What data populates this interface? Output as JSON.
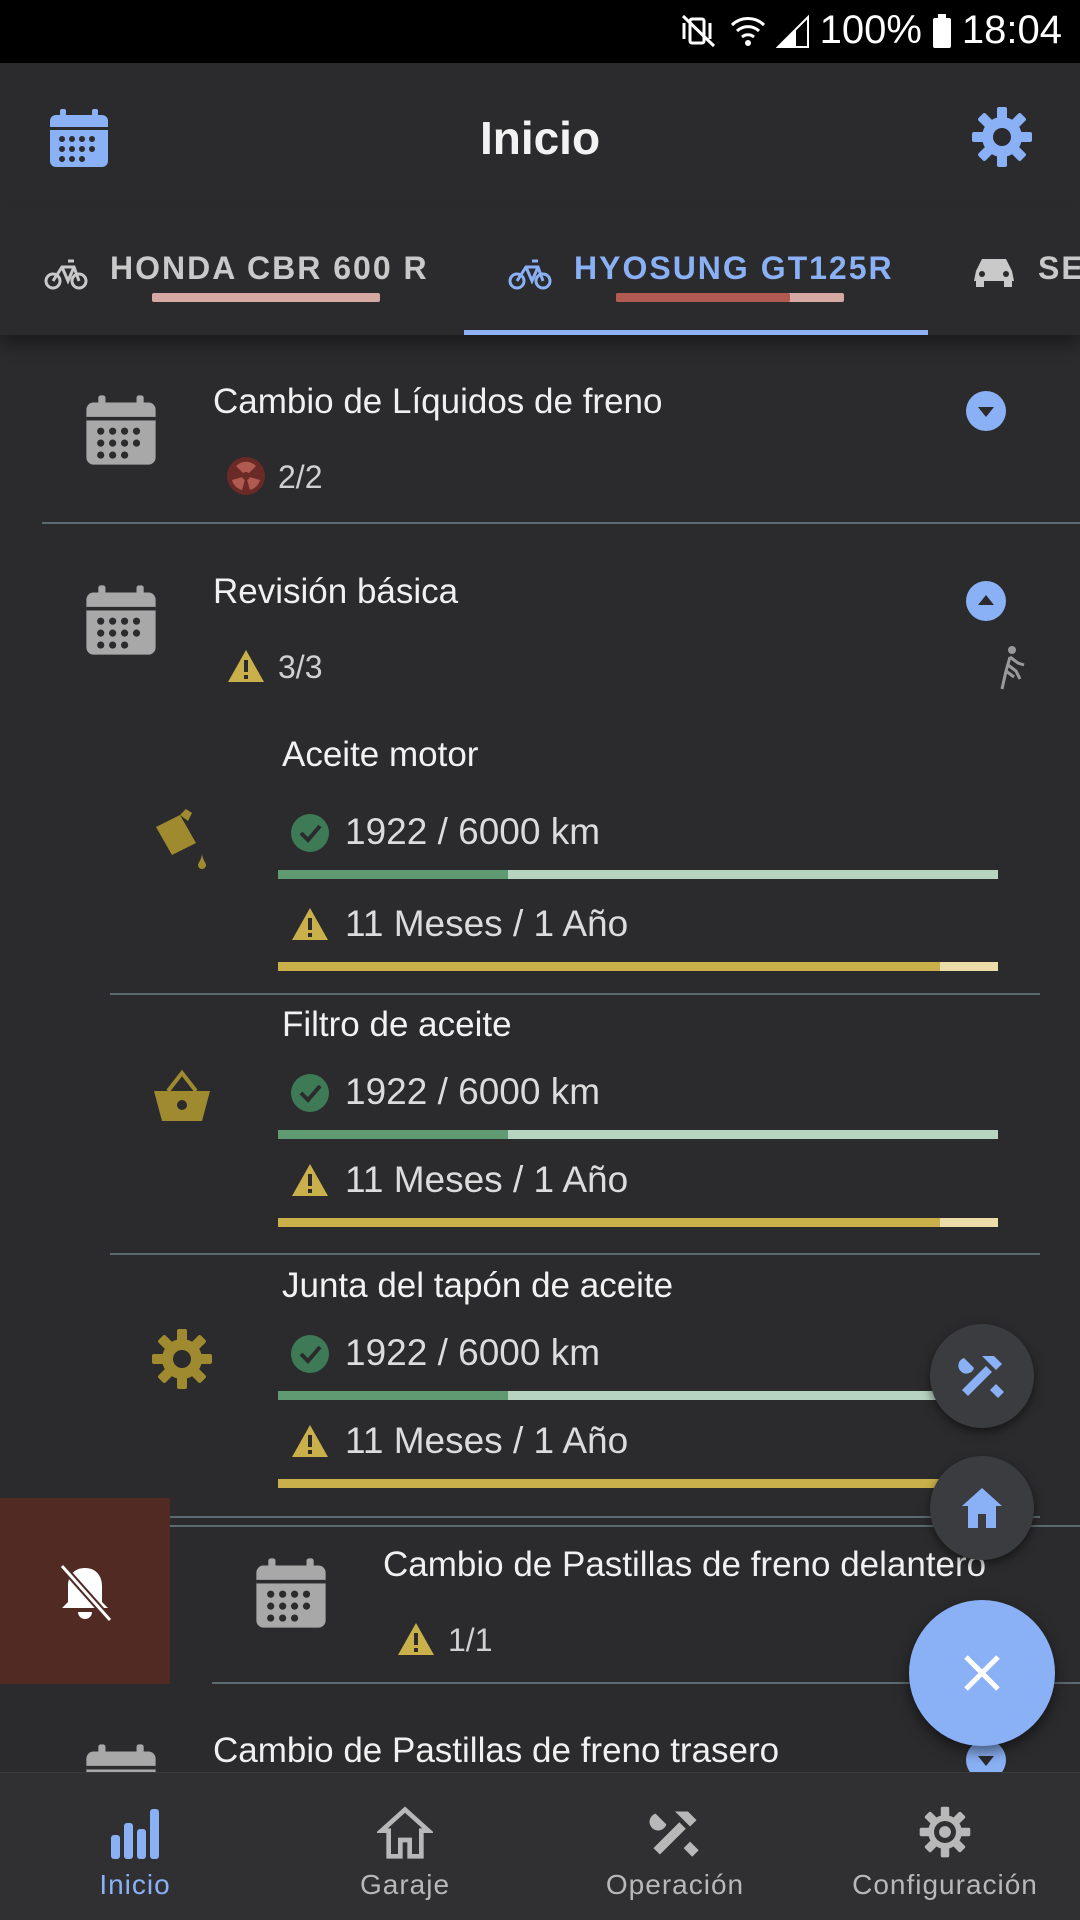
{
  "status_bar": {
    "battery": "100%",
    "time": "18:04"
  },
  "app_bar": {
    "title": "Inicio"
  },
  "tabs": [
    {
      "label": "HONDA CBR 600 R",
      "icon": "bike-icon",
      "selected": false
    },
    {
      "label": "HYOSUNG GT125R",
      "icon": "bike-icon",
      "selected": true
    },
    {
      "label": "SE",
      "icon": "car-icon",
      "selected": false
    }
  ],
  "sections": [
    {
      "title": "Cambio de Líquidos de freno",
      "count": "2/2",
      "status": "overdue",
      "expanded": false
    },
    {
      "title": "Revisión básica",
      "count": "3/3",
      "status": "warning",
      "expanded": true,
      "items": [
        {
          "title": "Aceite motor",
          "icon": "oil-can-icon",
          "km_text": "1922 / 6000 km",
          "km_progress": 0.32,
          "time_text": "11 Meses / 1 Año",
          "time_progress": 0.92
        },
        {
          "title": "Filtro de aceite",
          "icon": "basket-icon",
          "km_text": "1922 / 6000 km",
          "km_progress": 0.32,
          "time_text": "11 Meses / 1 Año",
          "time_progress": 0.92
        },
        {
          "title": "Junta del tapón de aceite",
          "icon": "gear-icon",
          "km_text": "1922 / 6000 km",
          "km_progress": 0.32,
          "time_text": "11 Meses / 1 Año",
          "time_progress": 0.92
        }
      ]
    },
    {
      "title": "Cambio de Pastillas de freno delantero",
      "count": "1/1",
      "status": "warning",
      "expanded": false
    },
    {
      "title": "Cambio de Pastillas de freno trasero",
      "expanded": false
    }
  ],
  "bottom_nav": [
    {
      "label": "Inicio",
      "icon": "bar-chart-icon",
      "active": true
    },
    {
      "label": "Garaje",
      "icon": "home-icon",
      "active": false
    },
    {
      "label": "Operación",
      "icon": "tools-icon",
      "active": false
    },
    {
      "label": "Configuración",
      "icon": "gear-icon",
      "active": false
    }
  ],
  "colors": {
    "accent": "#8ab0f5",
    "ok_green": "#5f9a72",
    "warning_yellow": "#c9b04a",
    "overdue_red": "#b15a52",
    "background": "#2b2b2d"
  }
}
